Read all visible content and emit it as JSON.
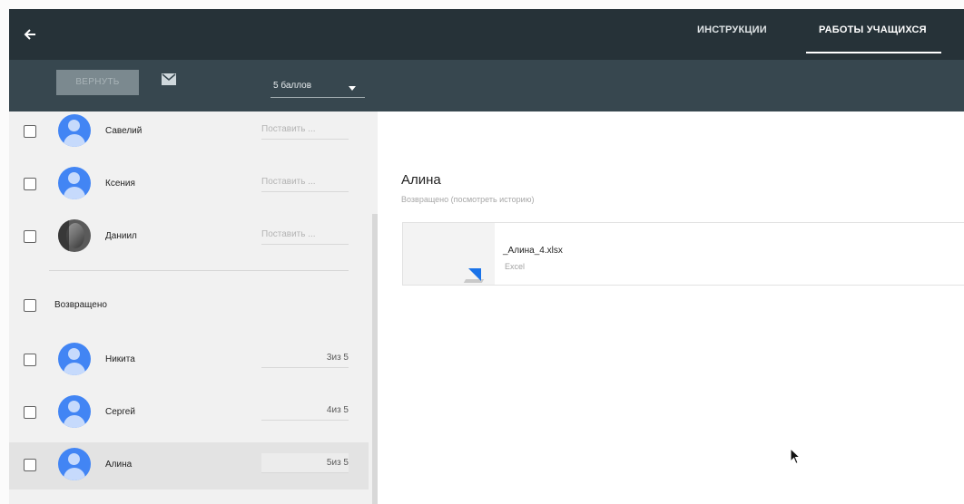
{
  "header": {
    "back_icon": "arrow-back-icon",
    "tabs": [
      {
        "label": "ИНСТРУКЦИИ",
        "active": false
      },
      {
        "label": "РАБОТЫ УЧАЩИХСЯ",
        "active": true
      }
    ]
  },
  "toolbar": {
    "return_label": "ВЕРНУТЬ",
    "mail_icon": "mail-icon",
    "points_value": "5 баллов"
  },
  "students": [
    {
      "name": "Савелий",
      "grade_placeholder": "Поставить ...",
      "avatar": "default"
    },
    {
      "name": "Ксения",
      "grade_placeholder": "Поставить ...",
      "avatar": "default"
    },
    {
      "name": "Даниил",
      "grade_placeholder": "Поставить ...",
      "avatar": "photo"
    }
  ],
  "returned_section": {
    "label": "Возвращено",
    "students": [
      {
        "name": "Никита",
        "grade": "3из 5",
        "avatar": "default"
      },
      {
        "name": "Сергей",
        "grade": "4из 5",
        "avatar": "default"
      },
      {
        "name": "Алина",
        "grade": "5из 5",
        "avatar": "default",
        "selected": true
      }
    ]
  },
  "detail": {
    "student_name": "Алина",
    "status": "Возвращено (посмотреть историю)",
    "attachment": {
      "file_name": "_Алина_4.xlsx",
      "file_type": "Excel"
    }
  },
  "colors": {
    "header_bg": "#263238",
    "toolbar_bg": "#37474f",
    "avatar_blue": "#4285f4",
    "list_bg": "#f1f1f1"
  }
}
